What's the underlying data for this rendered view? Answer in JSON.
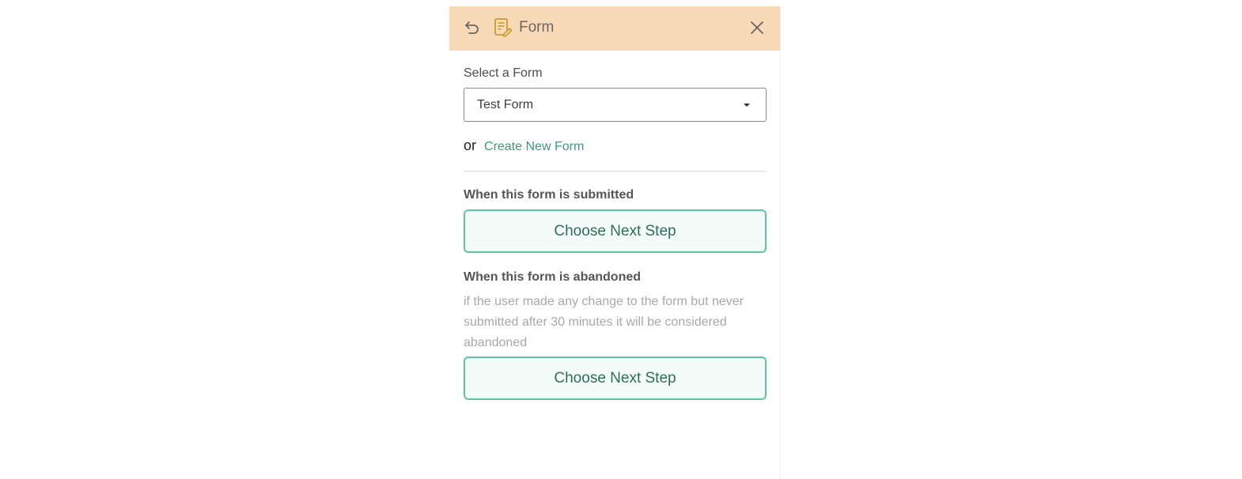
{
  "header": {
    "title": "Form",
    "back_icon": "undo-arrow-icon",
    "form_icon": "form-edit-icon",
    "close_icon": "close-icon",
    "background": "#f8d9b8"
  },
  "form_select": {
    "label": "Select a Form",
    "selected_value": "Test Form"
  },
  "create": {
    "or_text": "or",
    "link_label": "Create New Form",
    "link_color": "#3a9a7a"
  },
  "submitted": {
    "title": "When this form is submitted",
    "button_label": "Choose Next Step"
  },
  "abandoned": {
    "title": "When this form is abandoned",
    "description": "if the user made any change to the form but never submitted after 30 minutes it will be considered abandoned",
    "button_label": "Choose Next Step"
  },
  "accent": "#5fc4a0"
}
